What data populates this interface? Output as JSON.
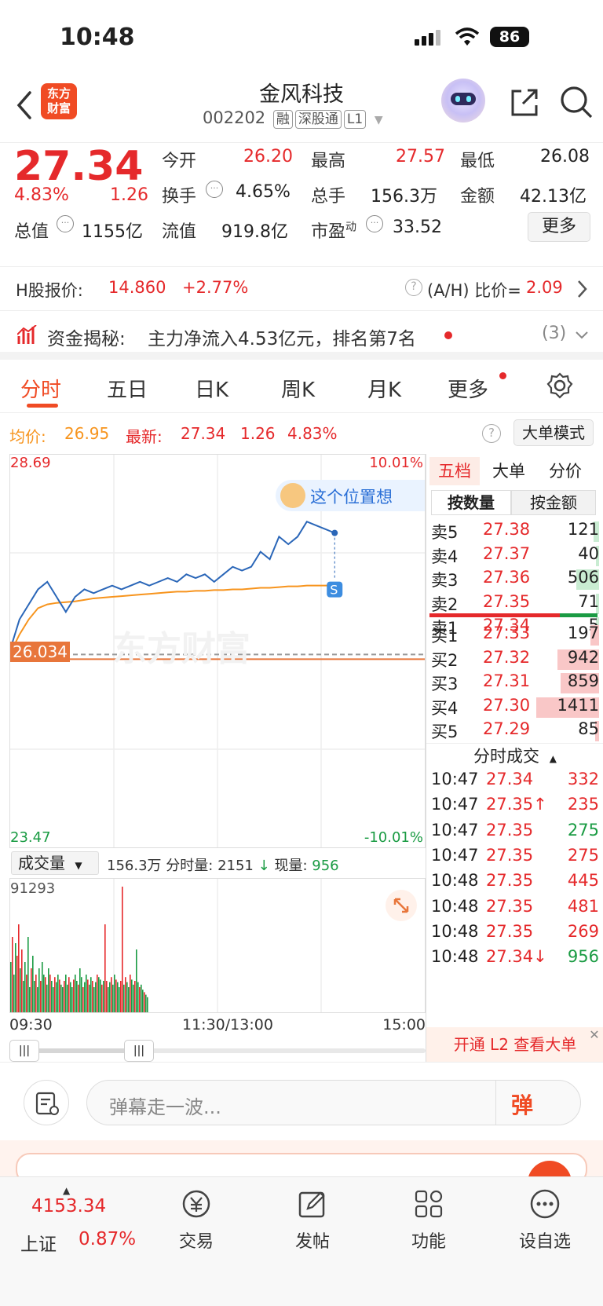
{
  "status_bar": {
    "time": "10:48",
    "battery": "86"
  },
  "nav": {
    "logo_text": "东方\n财富",
    "stock_name": "金风科技",
    "stock_code": "002202",
    "tags": [
      "融",
      "深股通",
      "L1"
    ]
  },
  "quote": {
    "price": "27.34",
    "change_pct": "4.83%",
    "change": "1.26",
    "open_label": "今开",
    "open": "26.20",
    "high_label": "最高",
    "high": "27.57",
    "low_label": "最低",
    "low": "26.08",
    "turnover_label": "换手",
    "turnover": "4.65%",
    "volume_label": "总手",
    "volume": "156.3万",
    "amount_label": "金额",
    "amount": "42.13亿",
    "mcap_label": "总值",
    "mcap": "1155亿",
    "float_label": "流值",
    "float": "919.8亿",
    "pe_label": "市盈",
    "pe_sup": "动",
    "pe": "33.52",
    "more_button": "更多"
  },
  "h_share": {
    "label": "H股报价:",
    "price": "14.860",
    "change": "+2.77%",
    "ratio_label": "(A/H) 比价=",
    "ratio": "2.09"
  },
  "fund_flow": {
    "label": "资金揭秘:",
    "text": "主力净流入4.53亿元，排名第7名",
    "count": "(3)"
  },
  "tabs": [
    "分时",
    "五日",
    "日K",
    "周K",
    "月K",
    "更多"
  ],
  "info_bar": {
    "avg_label": "均价:",
    "avg": "26.95",
    "latest_label": "最新:",
    "latest": "27.34",
    "change": "1.26",
    "pct": "4.83%",
    "big_order_button": "大单模式"
  },
  "chart_data": {
    "type": "line",
    "ylim": [
      23.47,
      28.69
    ],
    "y_ticks_left": [
      "28.69",
      "23.47"
    ],
    "y_ticks_right": [
      "10.01%",
      "-10.01%"
    ],
    "prev_close": "26.034",
    "x_ticks": [
      "09:30",
      "11:30/13:00",
      "15:00"
    ],
    "price": [
      26.1,
      26.5,
      26.7,
      26.9,
      27.0,
      26.8,
      26.6,
      26.8,
      26.9,
      26.85,
      26.9,
      26.95,
      26.9,
      26.95,
      27.0,
      26.95,
      27.0,
      27.05,
      27.0,
      27.1,
      27.05,
      27.1,
      27.0,
      27.1,
      27.2,
      27.15,
      27.2,
      27.4,
      27.3,
      27.6,
      27.5,
      27.6,
      27.8,
      27.75,
      27.7,
      27.65
    ],
    "avg": [
      26.05,
      26.3,
      26.5,
      26.65,
      26.7,
      26.72,
      26.73,
      26.74,
      26.76,
      26.78,
      26.79,
      26.8,
      26.81,
      26.82,
      26.83,
      26.84,
      26.85,
      26.86,
      26.87,
      26.87,
      26.88,
      26.88,
      26.89,
      26.89,
      26.9,
      26.9,
      26.91,
      26.92,
      26.92,
      26.93,
      26.94,
      26.94,
      26.95,
      26.95,
      26.95,
      26.95
    ],
    "volume_max_label": "91293",
    "volume": [
      40,
      60,
      30,
      55,
      45,
      70,
      35,
      50,
      25,
      40,
      30,
      60,
      20,
      35,
      45,
      25,
      30,
      20,
      35,
      25,
      40,
      30,
      28,
      22,
      35,
      30,
      25,
      20,
      28,
      24,
      30,
      26,
      22,
      20,
      25,
      30,
      22,
      28,
      24,
      20,
      26,
      30,
      25,
      22,
      35,
      28,
      20,
      24,
      30,
      26,
      22,
      28,
      25,
      20,
      24,
      30,
      28,
      26,
      22,
      25,
      70,
      25,
      20,
      24,
      28,
      22,
      30,
      26,
      24,
      20,
      25,
      100,
      22,
      28,
      24,
      20,
      30,
      26,
      22,
      25,
      50,
      24,
      20,
      22,
      18,
      16,
      14,
      12
    ]
  },
  "volume_bar": {
    "label": "成交量",
    "total": "156.3万",
    "period_label": "分时量:",
    "period": "2151",
    "arrow": "↓",
    "now_label": "现量:",
    "now": "956"
  },
  "order_book": {
    "tabs": [
      "五档",
      "大单",
      "分价"
    ],
    "subtabs": [
      "按数量",
      "按金额"
    ],
    "sells": [
      {
        "label": "卖5",
        "price": "27.38",
        "vol": "121"
      },
      {
        "label": "卖4",
        "price": "27.37",
        "vol": "40"
      },
      {
        "label": "卖3",
        "price": "27.36",
        "vol": "506"
      },
      {
        "label": "卖2",
        "price": "27.35",
        "vol": "71"
      },
      {
        "label": "卖1",
        "price": "27.34",
        "vol": "5"
      }
    ],
    "buys": [
      {
        "label": "买1",
        "price": "27.33",
        "vol": "197"
      },
      {
        "label": "买2",
        "price": "27.32",
        "vol": "942"
      },
      {
        "label": "买3",
        "price": "27.31",
        "vol": "859"
      },
      {
        "label": "买4",
        "price": "27.30",
        "vol": "1411"
      },
      {
        "label": "买5",
        "price": "27.29",
        "vol": "85"
      }
    ],
    "ticks_title": "分时成交",
    "ticks": [
      {
        "time": "10:47",
        "price": "27.34",
        "vol": "332",
        "color": "red"
      },
      {
        "time": "10:47",
        "price": "27.35↑",
        "vol": "235",
        "color": "red"
      },
      {
        "time": "10:47",
        "price": "27.35",
        "vol": "275",
        "color": "green"
      },
      {
        "time": "10:47",
        "price": "27.35",
        "vol": "275",
        "color": "red"
      },
      {
        "time": "10:48",
        "price": "27.35",
        "vol": "445",
        "color": "red"
      },
      {
        "time": "10:48",
        "price": "27.35",
        "vol": "481",
        "color": "red"
      },
      {
        "time": "10:48",
        "price": "27.35",
        "vol": "269",
        "color": "red"
      },
      {
        "time": "10:48",
        "price": "27.34↓",
        "vol": "956",
        "color": "green"
      }
    ],
    "l2_banner": "开通 L2 查看大单"
  },
  "tooltip_bubble": "这个位置想",
  "watermark": "东方财富",
  "danmu": {
    "placeholder": "弹幕走一波...",
    "send_icon": "弹"
  },
  "bottom_nav": {
    "index_value": "4153.34",
    "index_name": "上证",
    "index_pct": "0.87%",
    "items": [
      "交易",
      "发帖",
      "功能",
      "设自选"
    ]
  }
}
